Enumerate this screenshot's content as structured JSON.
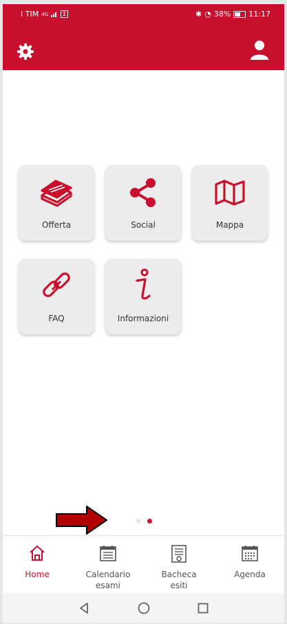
{
  "status_bar": {
    "carrier": "I TIM",
    "network": "4G",
    "notification": "Σ",
    "battery": "38%",
    "time": "11:17"
  },
  "tiles": [
    {
      "label": "Offerta",
      "icon": "books-stack-icon"
    },
    {
      "label": "Social",
      "icon": "share-icon"
    },
    {
      "label": "Mappa",
      "icon": "map-icon"
    },
    {
      "label": "FAQ",
      "icon": "link-icon"
    },
    {
      "label": "Informazioni",
      "icon": "info-icon"
    }
  ],
  "pager": {
    "pages": 2,
    "current": 2
  },
  "bottom_nav": [
    {
      "label": "Home",
      "icon": "home-icon",
      "active": true
    },
    {
      "label": "Calendario\nesami",
      "icon": "calendar-list-icon",
      "active": false
    },
    {
      "label": "Bacheca\nesiti",
      "icon": "board-results-icon",
      "active": false
    },
    {
      "label": "Agenda",
      "icon": "calendar-grid-icon",
      "active": false
    }
  ],
  "colors": {
    "brand": "#c8102e",
    "arrow": "#b30000"
  }
}
